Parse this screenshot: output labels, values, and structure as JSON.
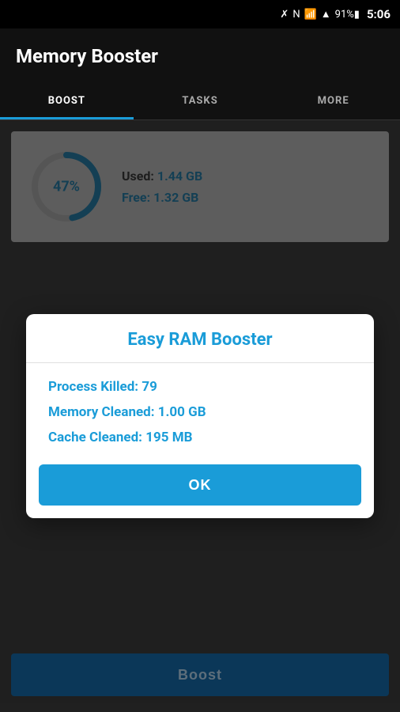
{
  "statusBar": {
    "battery": "91%",
    "time": "5:06"
  },
  "header": {
    "title": "Memory Booster"
  },
  "tabs": [
    {
      "label": "BOOST",
      "active": true
    },
    {
      "label": "TASKS",
      "active": false
    },
    {
      "label": "MORE",
      "active": false
    }
  ],
  "memoryCard": {
    "percentage": "47%",
    "used_label": "Used:",
    "used_value": "1.44 GB",
    "free_label": "Free:",
    "free_value": "1.32 GB"
  },
  "dialog": {
    "title": "Easy RAM Booster",
    "stats": [
      {
        "label": "Process Killed:",
        "value": "79"
      },
      {
        "label": "Memory Cleaned:",
        "value": "1.00 GB"
      },
      {
        "label": "Cache Cleaned:",
        "value": "195 MB"
      }
    ],
    "ok_label": "OK"
  },
  "boostButton": {
    "label": "Boost"
  }
}
